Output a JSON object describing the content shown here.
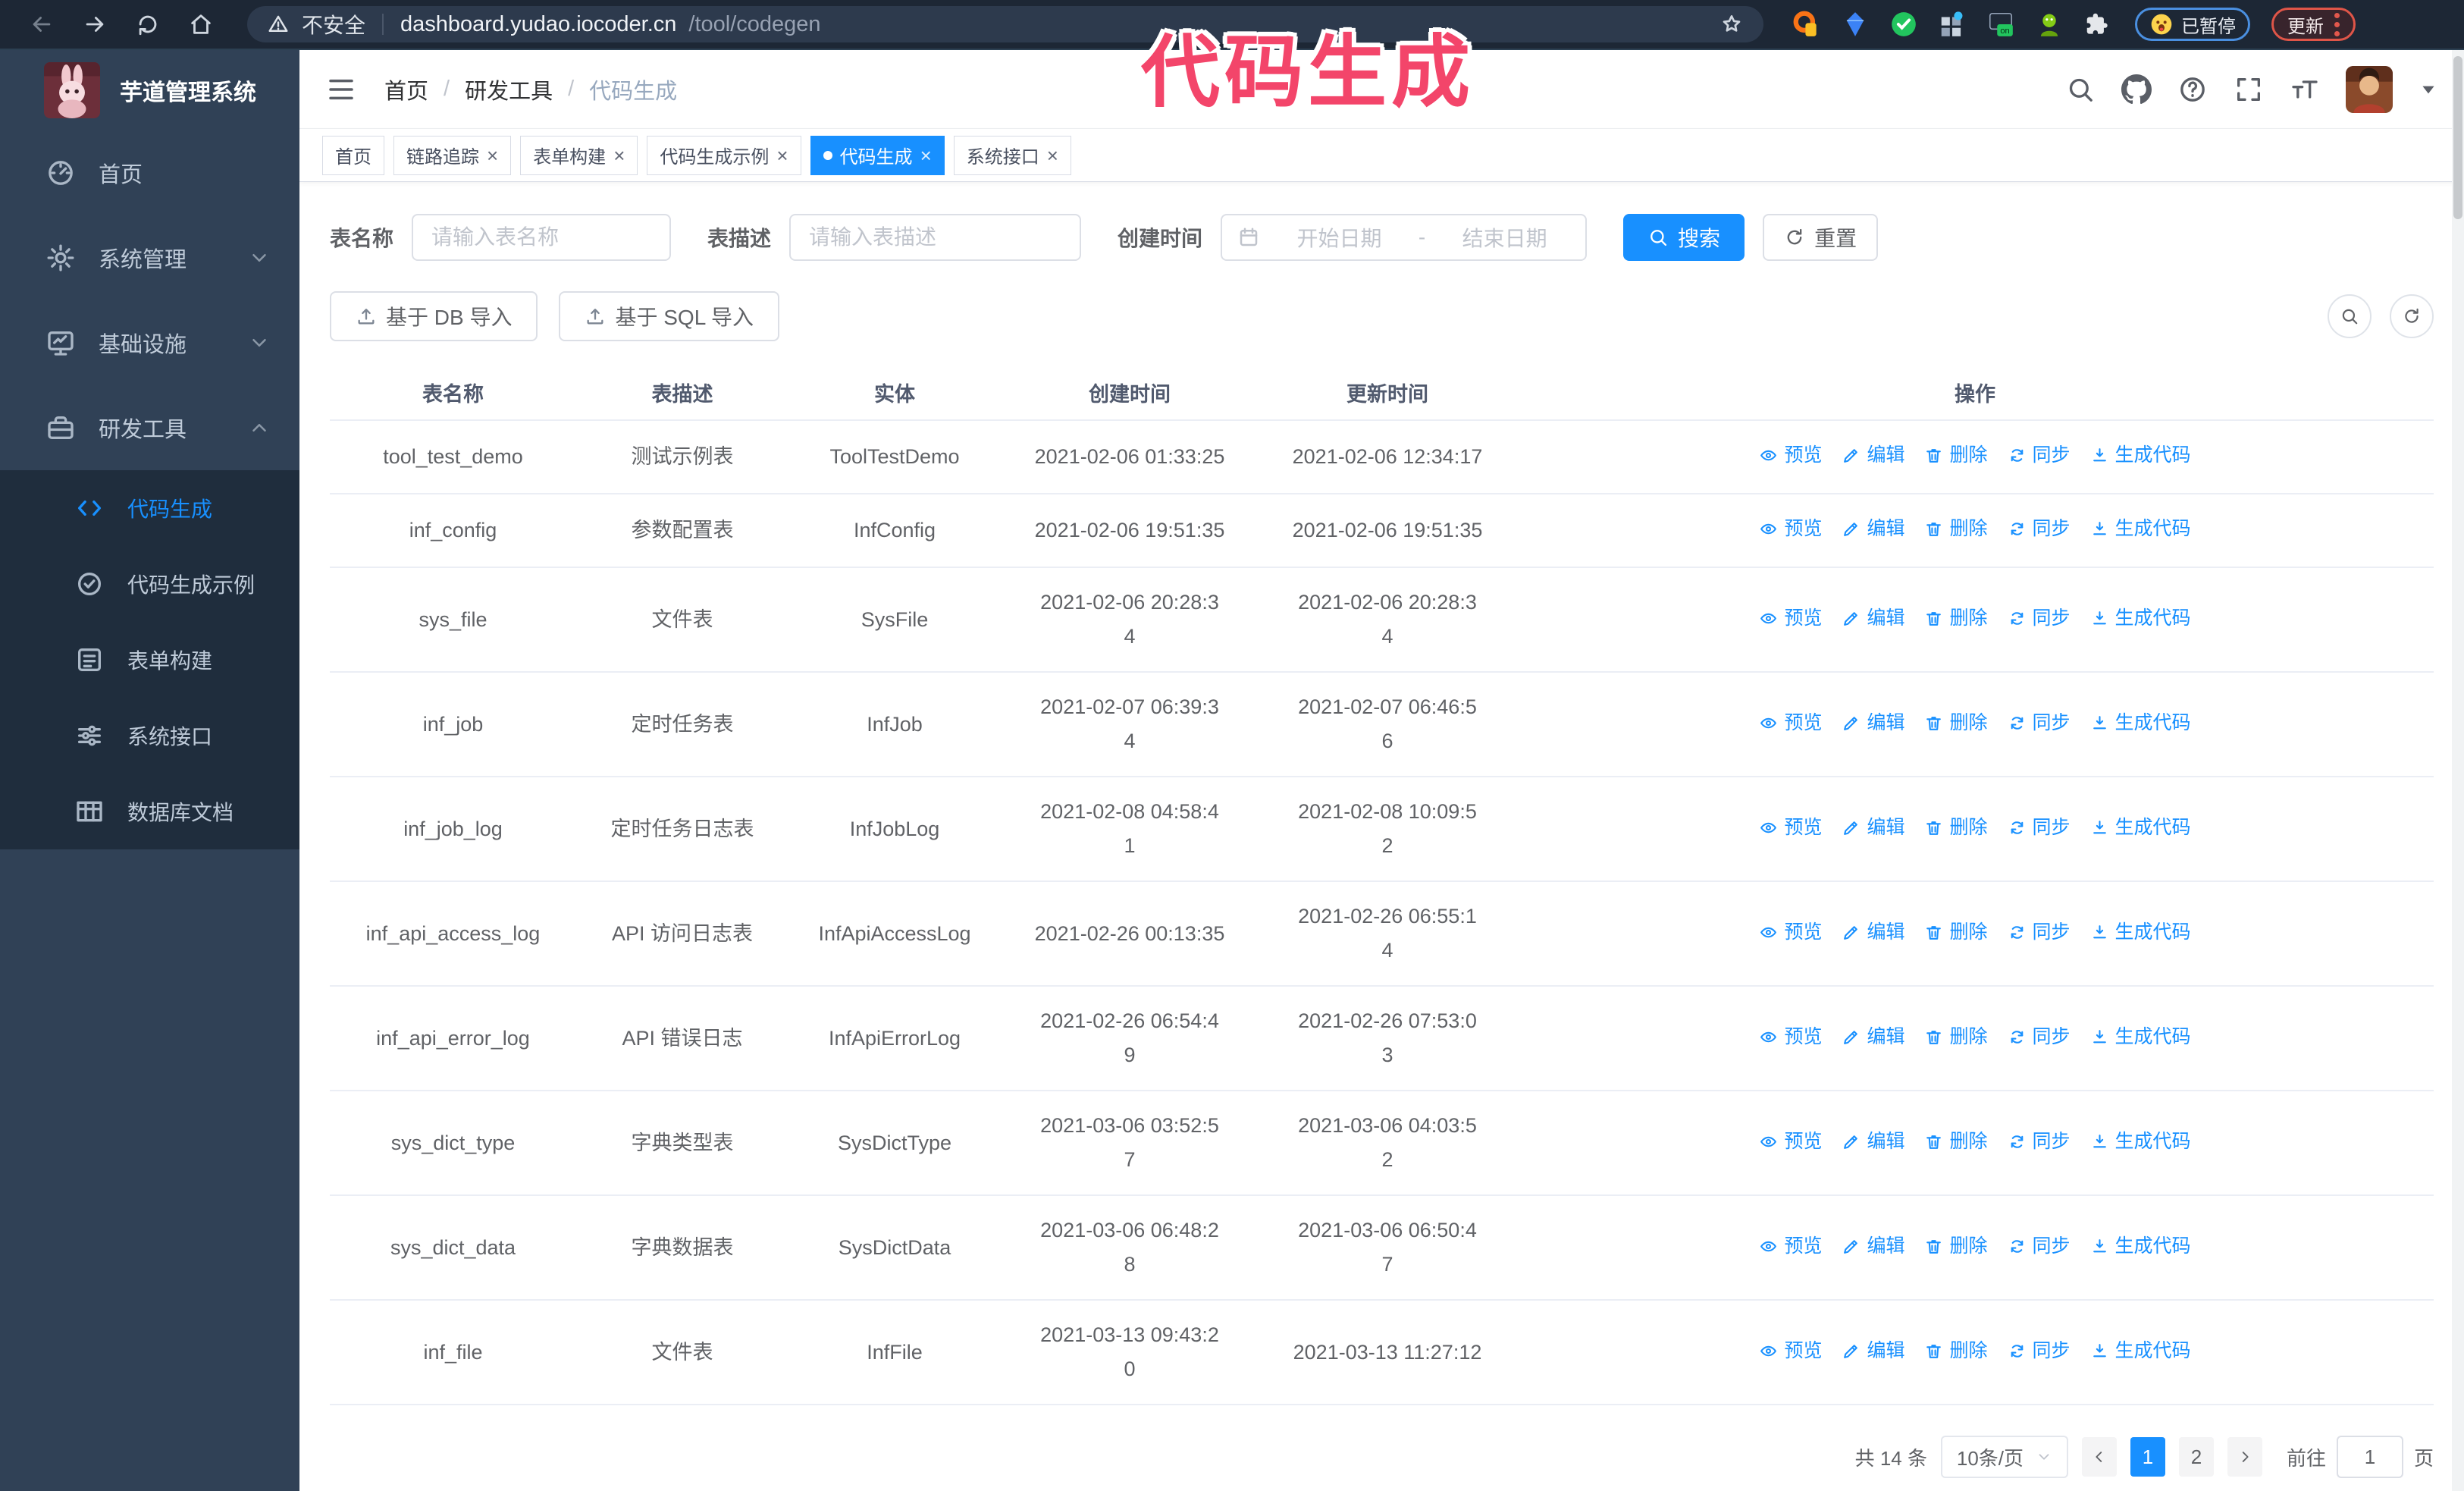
{
  "colors": {
    "primary": "#1890ff",
    "sidebar_bg": "#304156",
    "submenu_bg": "#1f2d3d",
    "overlay": "#f3456a",
    "chrome_bg": "#1d2735"
  },
  "browser": {
    "security_label": "不安全",
    "url_host": "dashboard.yudao.iocoder.cn",
    "url_path": "/tool/codegen",
    "nav_icons": [
      "back-arrow-icon",
      "forward-arrow-icon",
      "reload-icon",
      "home-icon"
    ],
    "extensions": [
      "orange-extension-icon",
      "gem-extension-icon",
      "check-extension-icon",
      "grid-extension-icon",
      "recorder-on-extension-icon",
      "green-extension-icon",
      "puzzle-icon"
    ],
    "paused_badge": "已暂停",
    "update_button": "更新"
  },
  "overlay": {
    "title": "代码生成"
  },
  "sidebar": {
    "logo_title": "芋道管理系统",
    "items": [
      {
        "key": "home",
        "label": "首页",
        "icon": "dashboard-icon",
        "expandable": false,
        "expanded": false
      },
      {
        "key": "system",
        "label": "系统管理",
        "icon": "gear-icon",
        "expandable": true,
        "expanded": false
      },
      {
        "key": "infra",
        "label": "基础设施",
        "icon": "monitor-icon",
        "expandable": true,
        "expanded": false
      },
      {
        "key": "devtools",
        "label": "研发工具",
        "icon": "toolbox-icon",
        "expandable": true,
        "expanded": true
      }
    ],
    "submenu": [
      {
        "key": "codegen",
        "label": "代码生成",
        "icon": "code-icon",
        "active": true
      },
      {
        "key": "codegen-example",
        "label": "代码生成示例",
        "icon": "example-check-icon",
        "active": false
      },
      {
        "key": "form-build",
        "label": "表单构建",
        "icon": "form-icon",
        "active": false
      },
      {
        "key": "system-api",
        "label": "系统接口",
        "icon": "sliders-icon",
        "active": false
      },
      {
        "key": "db-doc",
        "label": "数据库文档",
        "icon": "table-grid-icon",
        "active": false
      }
    ]
  },
  "header": {
    "breadcrumb": [
      "首页",
      "研发工具",
      "代码生成"
    ],
    "right_icons": [
      "search-icon",
      "github-icon",
      "help-icon",
      "fullscreen-icon",
      "font-size-icon",
      "avatar",
      "caret-down-icon"
    ]
  },
  "tabs": [
    {
      "key": "home",
      "label": "首页",
      "closable": false,
      "active": false
    },
    {
      "key": "tracing",
      "label": "链路追踪",
      "closable": true,
      "active": false
    },
    {
      "key": "form-build",
      "label": "表单构建",
      "closable": true,
      "active": false
    },
    {
      "key": "codegen-example",
      "label": "代码生成示例",
      "closable": true,
      "active": false
    },
    {
      "key": "codegen",
      "label": "代码生成",
      "closable": true,
      "active": true
    },
    {
      "key": "system-api",
      "label": "系统接口",
      "closable": true,
      "active": false
    }
  ],
  "filters": {
    "table_name_label": "表名称",
    "table_name_placeholder": "请输入表名称",
    "table_desc_label": "表描述",
    "table_desc_placeholder": "请输入表描述",
    "create_time_label": "创建时间",
    "date_start_placeholder": "开始日期",
    "date_separator": "-",
    "date_end_placeholder": "结束日期",
    "search_button": "搜索",
    "reset_button": "重置"
  },
  "toolbar": {
    "import_db_button": "基于 DB 导入",
    "import_sql_button": "基于 SQL 导入"
  },
  "table": {
    "columns": [
      "表名称",
      "表描述",
      "实体",
      "创建时间",
      "更新时间",
      "操作"
    ],
    "actions": [
      {
        "key": "preview",
        "label": "预览",
        "icon": "eye-icon"
      },
      {
        "key": "edit",
        "label": "编辑",
        "icon": "edit-icon"
      },
      {
        "key": "delete",
        "label": "删除",
        "icon": "trash-icon"
      },
      {
        "key": "sync",
        "label": "同步",
        "icon": "sync-icon"
      },
      {
        "key": "generate",
        "label": "生成代码",
        "icon": "download-icon"
      }
    ],
    "rows": [
      {
        "name": "tool_test_demo",
        "desc": "测试示例表",
        "entity": "ToolTestDemo",
        "create_time": "2021-02-06 01:33:25",
        "update_time": "2021-02-06 12:34:17"
      },
      {
        "name": "inf_config",
        "desc": "参数配置表",
        "entity": "InfConfig",
        "create_time": "2021-02-06 19:51:35",
        "update_time": "2021-02-06 19:51:35"
      },
      {
        "name": "sys_file",
        "desc": "文件表",
        "entity": "SysFile",
        "create_time": "2021-02-06 20:28:3\n4",
        "update_time": "2021-02-06 20:28:3\n4"
      },
      {
        "name": "inf_job",
        "desc": "定时任务表",
        "entity": "InfJob",
        "create_time": "2021-02-07 06:39:3\n4",
        "update_time": "2021-02-07 06:46:5\n6"
      },
      {
        "name": "inf_job_log",
        "desc": "定时任务日志表",
        "entity": "InfJobLog",
        "create_time": "2021-02-08 04:58:4\n1",
        "update_time": "2021-02-08 10:09:5\n2"
      },
      {
        "name": "inf_api_access_log",
        "desc": "API 访问日志表",
        "entity": "InfApiAccessLog",
        "create_time": "2021-02-26 00:13:35",
        "update_time": "2021-02-26 06:55:1\n4"
      },
      {
        "name": "inf_api_error_log",
        "desc": "API 错误日志",
        "entity": "InfApiErrorLog",
        "create_time": "2021-02-26 06:54:4\n9",
        "update_time": "2021-02-26 07:53:0\n3"
      },
      {
        "name": "sys_dict_type",
        "desc": "字典类型表",
        "entity": "SysDictType",
        "create_time": "2021-03-06 03:52:5\n7",
        "update_time": "2021-03-06 04:03:5\n2"
      },
      {
        "name": "sys_dict_data",
        "desc": "字典数据表",
        "entity": "SysDictData",
        "create_time": "2021-03-06 06:48:2\n8",
        "update_time": "2021-03-06 06:50:4\n7"
      },
      {
        "name": "inf_file",
        "desc": "文件表",
        "entity": "InfFile",
        "create_time": "2021-03-13 09:43:2\n0",
        "update_time": "2021-03-13 11:27:12"
      }
    ]
  },
  "pagination": {
    "total_text": "共 14 条",
    "page_size": "10条/页",
    "pages": [
      {
        "label": "1",
        "active": true
      },
      {
        "label": "2",
        "active": false
      }
    ],
    "goto_label": "前往",
    "goto_value": "1",
    "goto_suffix": "页"
  }
}
